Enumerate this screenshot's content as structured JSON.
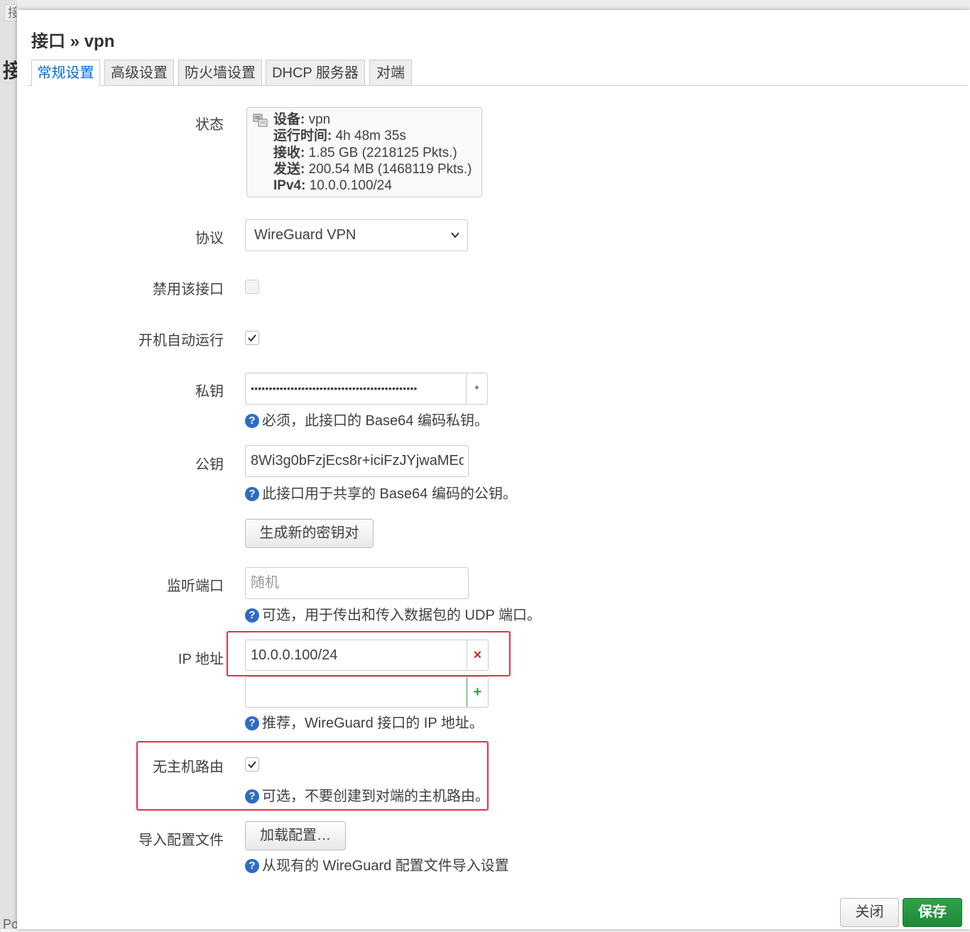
{
  "background": {
    "tab_fragments": [
      "接",
      "",
      ""
    ],
    "heading_fragment": "接",
    "footer_fragment": "Po"
  },
  "modal": {
    "title": "接口 » vpn",
    "tabs": [
      "常规设置",
      "高级设置",
      "防火墙设置",
      "DHCP 服务器",
      "对端"
    ],
    "active_tab": 0
  },
  "status": {
    "label": "状态",
    "icon": "network-interface-icon",
    "device_key": "设备:",
    "device_val": " vpn",
    "uptime_key": "运行时间:",
    "uptime_val": " 4h 48m 35s",
    "rx_key": "接收:",
    "rx_val": " 1.85 GB (2218125 Pkts.)",
    "tx_key": "发送:",
    "tx_val": " 200.54 MB (1468119 Pkts.)",
    "ipv4_key": "IPv4:",
    "ipv4_val": " 10.0.0.100/24"
  },
  "protocol": {
    "label": "协议",
    "value": "WireGuard VPN"
  },
  "disable_iface": {
    "label": "禁用该接口",
    "checked": false
  },
  "autostart": {
    "label": "开机自动运行",
    "checked": true
  },
  "private_key": {
    "label": "私钥",
    "masked_value": "••••••••••••••••••••••••••••••••••••••••••••••",
    "reveal_button": "*",
    "help": "必须，此接口的 Base64 编码私钥。"
  },
  "public_key": {
    "label": "公钥",
    "value": "8Wi3g0bFzjEcs8r+iciFzJYjwaMEd\\",
    "help": "此接口用于共享的 Base64 编码的公钥。",
    "generate_button": "生成新的密钥对"
  },
  "listen_port": {
    "label": "监听端口",
    "placeholder": "随机",
    "help": "可选，用于传出和传入数据包的 UDP 端口。"
  },
  "ip_address": {
    "label": "IP 地址",
    "entries": [
      "10.0.0.100/24"
    ],
    "remove_button": "×",
    "add_button": "+",
    "help": "推荐，WireGuard 接口的 IP 地址。"
  },
  "no_host_route": {
    "label": "无主机路由",
    "checked": true,
    "help": "可选，不要创建到对端的主机路由。"
  },
  "import_config": {
    "label": "导入配置文件",
    "button": "加载配置…",
    "help": "从现有的 WireGuard 配置文件导入设置"
  },
  "footer": {
    "close_button": "关闭",
    "save_button": "保存"
  },
  "help_icon_glyph": "?",
  "colors": {
    "accent": "#0069d6",
    "save": "#1e8a38",
    "highlight": "#e0334b",
    "help_icon": "#2d6cc5"
  }
}
